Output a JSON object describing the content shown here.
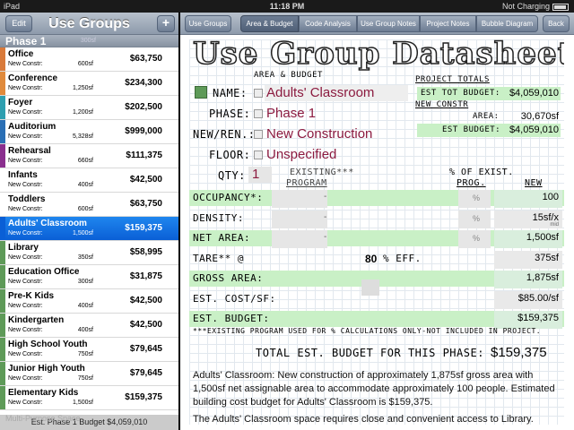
{
  "status_bar": {
    "device": "iPad",
    "time": "11:18 PM",
    "battery": "Not Charging"
  },
  "left_panel": {
    "edit_label": "Edit",
    "title": "Use Groups",
    "add_label": "+",
    "section": "Phase 1",
    "section_ghost": "300sf",
    "items": [
      {
        "name": "Office",
        "sub": "New Constr:",
        "sf": "600sf",
        "cost": "$63,750",
        "color": "#d97a3a"
      },
      {
        "name": "Conference",
        "sub": "New Constr:",
        "sf": "1,250sf",
        "cost": "$234,300",
        "color": "#e08a3c"
      },
      {
        "name": "Foyer",
        "sub": "New Constr:",
        "sf": "1,200sf",
        "cost": "$202,500",
        "color": "#2e9fb0"
      },
      {
        "name": "Auditorium",
        "sub": "New Constr:",
        "sf": "5,328sf",
        "cost": "$999,000",
        "color": "#2a6fb5"
      },
      {
        "name": "Rehearsal",
        "sub": "New Constr:",
        "sf": "660sf",
        "cost": "$111,375",
        "color": "#8a2f8e"
      },
      {
        "name": "Infants",
        "sub": "New Constr:",
        "sf": "400sf",
        "cost": "$42,500",
        "color": "#ffffff"
      },
      {
        "name": "Toddlers",
        "sub": "New Constr:",
        "sf": "600sf",
        "cost": "$63,750",
        "color": "#ffffff"
      },
      {
        "name": "Adults' Classroom",
        "sub": "New Constr:",
        "sf": "1,500sf",
        "cost": "$159,375",
        "color": "#0a5fd6"
      },
      {
        "name": "Library",
        "sub": "New Constr:",
        "sf": "350sf",
        "cost": "$58,995",
        "color": "#5e9a58"
      },
      {
        "name": "Education Office",
        "sub": "New Constr:",
        "sf": "300sf",
        "cost": "$31,875",
        "color": "#5e9a58"
      },
      {
        "name": "Pre-K Kids",
        "sub": "New Constr:",
        "sf": "400sf",
        "cost": "$42,500",
        "color": "#5e9a58"
      },
      {
        "name": "Kindergarten",
        "sub": "New Constr:",
        "sf": "400sf",
        "cost": "$42,500",
        "color": "#5e9a58"
      },
      {
        "name": "High School Youth",
        "sub": "New Constr:",
        "sf": "750sf",
        "cost": "$79,645",
        "color": "#5e9a58"
      },
      {
        "name": "Junior High Youth",
        "sub": "New Constr:",
        "sf": "750sf",
        "cost": "$79,645",
        "color": "#5e9a58"
      },
      {
        "name": "Elementary Kids",
        "sub": "New Constr:",
        "sf": "1,500sf",
        "cost": "$159,375",
        "color": "#5e9a58"
      }
    ],
    "footer_under": "Multi-Purpose Space",
    "footer": "Est. Phase 1 Budget $4,059,010"
  },
  "toolbar": {
    "tabs": [
      "Use Groups",
      "Area & Budget",
      "Code Analysis",
      "Use Group Notes",
      "Project Notes",
      "Bubble Diagram",
      "Back"
    ],
    "active_tab": "Area & Budget"
  },
  "sheet": {
    "title": "Use Group Datasheet",
    "subtitle": "AREA & BUDGET",
    "name_label": "NAME:",
    "name_value": "Adults' Classroom",
    "phase_label": "PHASE:",
    "phase_value": "Phase 1",
    "newren_label": "NEW/REN.:",
    "newren_value": "New Construction",
    "floor_label": "FLOOR:",
    "floor_value": "Unspecified",
    "qty_label": "QTY:",
    "qty_value": "1",
    "existing_header": "EXISTING***",
    "program_header": "PROGRAM",
    "pct_header": "% OF EXIST.",
    "prog_header": "PROG.",
    "new_header": "NEW",
    "project_totals": {
      "label": "PROJECT TOTALS",
      "est_tot_budget_label": "EST TOT BUDGET:",
      "est_tot_budget_value": "$4,059,010",
      "new_constr_label": "NEW CONSTR",
      "area_label": "AREA:",
      "area_value": "30,670sf",
      "est_budget_label": "EST BUDGET:",
      "est_budget_value": "$4,059,010"
    },
    "rows": [
      {
        "label": "OCCUPANCY*:",
        "existing": "-",
        "pct": "%",
        "new": "100",
        "note": "",
        "green": true
      },
      {
        "label": "DENSITY:",
        "existing": "-",
        "pct": "%",
        "new": "15sf/x",
        "note": "mid",
        "green": false
      },
      {
        "label": "NET AREA:",
        "existing": "-",
        "pct": "%",
        "new": "1,500sf",
        "note": "",
        "green": true
      },
      {
        "label": "TARE** @",
        "existing": "",
        "pct": "",
        "new": "375sf",
        "note": "",
        "green": false
      },
      {
        "label": "GROSS AREA:",
        "existing": "",
        "pct": "",
        "new": "1,875sf",
        "note": "",
        "green": true
      },
      {
        "label": "EST. COST/SF:",
        "existing": "",
        "pct": "",
        "new": "$85.00/sf",
        "note": "",
        "green": false
      },
      {
        "label": "EST. BUDGET:",
        "existing": "",
        "pct": "",
        "new": "$159,375",
        "note": "",
        "green": true
      }
    ],
    "tare_value": "80",
    "tare_suffix": "% EFF.",
    "footnote": "***EXISTING PROGRAM USED FOR % CALCULATIONS ONLY-NOT INCLUDED IN PROJECT.",
    "total_label": "TOTAL EST. BUDGET FOR THIS PHASE:",
    "total_value": "$159,375",
    "paragraph1": "Adults' Classroom: New construction of approximately 1,875sf gross area with 1,500sf net assignable area to accommodate approximately 100 people. Estimated building cost budget for Adults' Classroom is $159,375.",
    "paragraph2": "The Adults' Classroom space requires close and convenient access to Library."
  }
}
